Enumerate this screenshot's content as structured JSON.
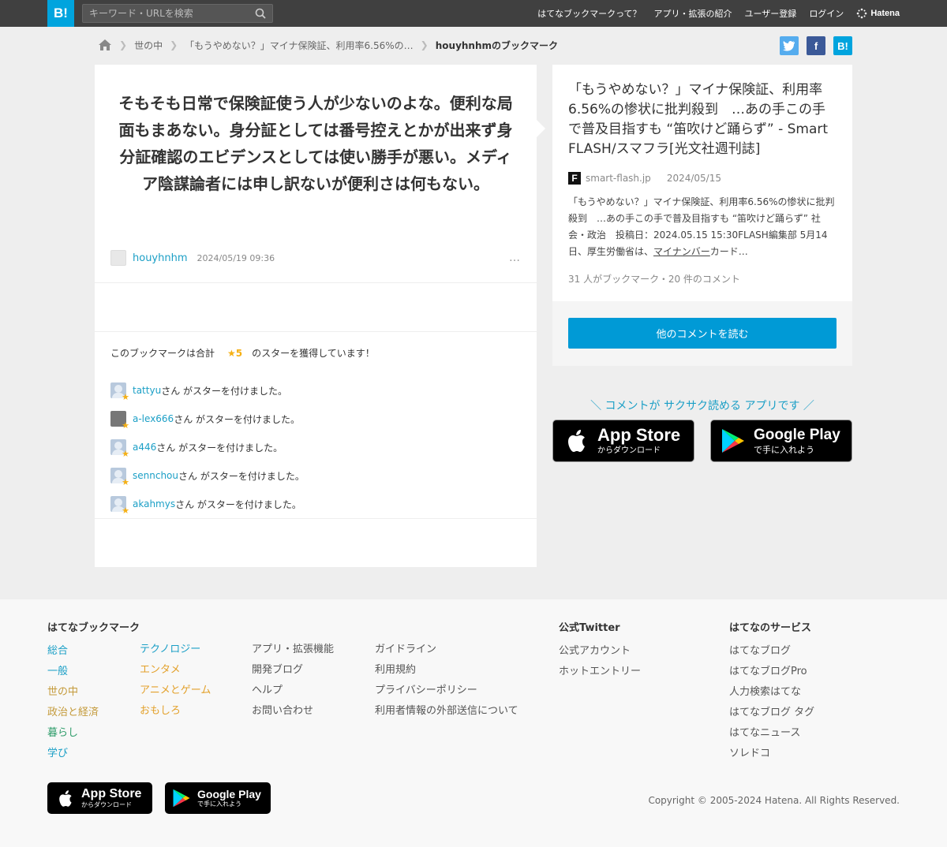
{
  "header": {
    "logo": "B!",
    "search_placeholder": "キーワード・URLを検索",
    "nav": [
      "はてなブックマークって？",
      "アプリ・拡張の紹介",
      "ユーザー登録",
      "ログイン"
    ],
    "brand": "Hatena"
  },
  "breadcrumb": {
    "items": [
      "世の中",
      "「もうやめない？」マイナ保険証、利用率6.56%の…"
    ],
    "current": "houyhnhmのブックマーク"
  },
  "comment": {
    "text": "そもそも日常で保険証使う人が少ないのよな。便利な局面もまあない。身分証としては番号控えとかが出来ず身分証確認のエビデンスとしては使い勝手が悪い。メディア陰謀論者には申し訳ないが便利さは何もない。",
    "user": "houyhnhm",
    "date": "2024/05/19 09:36",
    "more": "…"
  },
  "stars": {
    "prefix": "このブックマークは合計",
    "count": "★5",
    "suffix": "のスターを獲得しています！",
    "action": "さん がスターを付けました。",
    "users": [
      "tattyu",
      "a-lex666",
      "a446",
      "sennchou",
      "akahmys"
    ]
  },
  "article": {
    "title": "「もうやめない？」マイナ保険証、利用率6.56%の惨状に批判殺到　…あの手この手で普及目指すも “笛吹けど踊らず” - Smart FLASH/スマフラ[光文社週刊誌]",
    "favicon": "F",
    "domain": "smart-flash.jp",
    "date": "2024/05/15",
    "summary_a": "「もうやめない？」マイナ保険証、利用率6.56%の惨状に批判殺到　…あの手この手で普及目指すも “笛吹けど踊らず” 社会・政治　投稿日：2024.05.15 15:30FLASH編集部 5月14日、厚生労働省は、",
    "summary_u": "マイナンバー",
    "summary_b": "カード…",
    "stats": "31 人がブックマーク・20 件のコメント"
  },
  "read_more": "他のコメントを読む",
  "app_promo": {
    "tagline": "＼ コメントが サクサク読める アプリです ／",
    "appstore_big": "App Store",
    "appstore_small": "からダウンロード",
    "google_big": "Google Play",
    "google_small": "で手に入れよう"
  },
  "footer": {
    "bookmark_title": "はてなブックマーク",
    "categories_a": [
      "総合",
      "一般",
      "世の中",
      "政治と経済",
      "暮らし",
      "学び"
    ],
    "categories_b": [
      "テクノロジー",
      "エンタメ",
      "アニメとゲーム",
      "おもしろ"
    ],
    "links_a": [
      "アプリ・拡張機能",
      "開発ブログ",
      "ヘルプ",
      "お問い合わせ"
    ],
    "links_b": [
      "ガイドライン",
      "利用規約",
      "プライバシーポリシー",
      "利用者情報の外部送信について"
    ],
    "twitter_title": "公式Twitter",
    "twitter_links": [
      "公式アカウント",
      "ホットエントリー"
    ],
    "services_title": "はてなのサービス",
    "services": [
      "はてなブログ",
      "はてなブログPro",
      "人力検索はてな",
      "はてなブログ タグ",
      "はてなニュース",
      "ソレドコ"
    ],
    "copyright": "Copyright © 2005-2024 Hatena. All Rights Reserved."
  },
  "colors": {
    "accent": "#00a4de",
    "link": "#1b9fc6",
    "star": "#f5b015",
    "cat_general": "#1b9fc6",
    "cat_social": "#c49a3a",
    "cat_life": "#2e9c6a",
    "cat_tech": "#1b9fc6",
    "cat_ent": "#e3a12b"
  }
}
